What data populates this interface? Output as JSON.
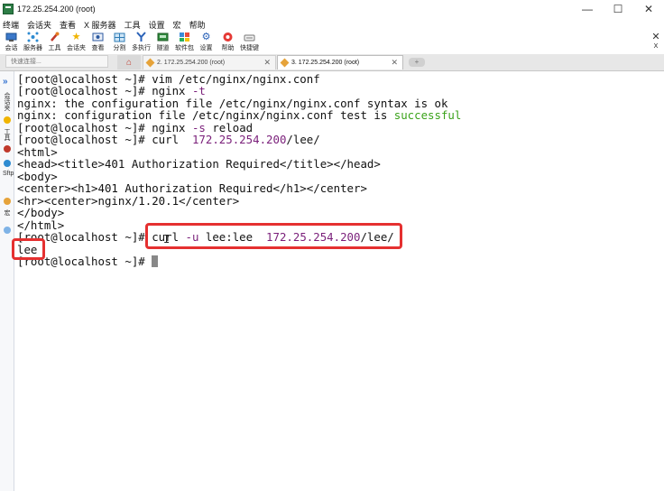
{
  "window": {
    "title": "172.25.254.200 (root)"
  },
  "window_controls": {
    "minimize": "—",
    "maximize": "☐",
    "close": "✕"
  },
  "menu": [
    "终端",
    "会话夹",
    "查看",
    "X 服务器",
    "工具",
    "设置",
    "宏",
    "帮助"
  ],
  "toolbar": {
    "items": [
      {
        "label": "会话",
        "icon": "session-icon"
      },
      {
        "label": "服务器",
        "icon": "servers-icon"
      },
      {
        "label": "工具",
        "icon": "tools-icon"
      },
      {
        "label": "会话夹",
        "icon": "star-icon"
      },
      {
        "label": "查看",
        "icon": "view-icon"
      },
      {
        "label": "分割",
        "icon": "split-icon"
      },
      {
        "label": "多执行",
        "icon": "multiexec-icon"
      },
      {
        "label": "隧道",
        "icon": "tunnel-icon"
      },
      {
        "label": "软件包",
        "icon": "packages-icon"
      },
      {
        "label": "设置",
        "icon": "settings-icon"
      },
      {
        "label": "帮助",
        "icon": "help-icon"
      },
      {
        "label": "快捷键",
        "icon": "keyboard-icon"
      }
    ],
    "right_label": "X"
  },
  "tabs": {
    "quick_connect_placeholder": "快速连接...",
    "items": [
      {
        "label": "2. 172.25.254.200 (root)"
      },
      {
        "label": "3. 172.25.254.200 (root)"
      }
    ]
  },
  "sidebar": {
    "labels": [
      "会话夹",
      "工具",
      "Sftp",
      "宏"
    ]
  },
  "terminal": {
    "lines": [
      [
        {
          "t": "[root@localhost ~]# vim /etc/nginx/nginx.conf",
          "c": "prompt"
        }
      ],
      [
        {
          "t": "[root@localhost ~]# nginx ",
          "c": "prompt"
        },
        {
          "t": "-t",
          "c": "opt"
        }
      ],
      [
        {
          "t": "nginx: the configuration file /etc/nginx/nginx.conf syntax is ok",
          "c": "prompt"
        }
      ],
      [
        {
          "t": "nginx: configuration file /etc/nginx/nginx.conf test is ",
          "c": "prompt"
        },
        {
          "t": "successful",
          "c": "ok"
        }
      ],
      [
        {
          "t": "[root@localhost ~]# nginx ",
          "c": "prompt"
        },
        {
          "t": "-s",
          "c": "opt"
        },
        {
          "t": " reload",
          "c": "prompt"
        }
      ],
      [
        {
          "t": "[root@localhost ~]# curl  ",
          "c": "prompt"
        },
        {
          "t": "172.25.254.200",
          "c": "num"
        },
        {
          "t": "/lee/",
          "c": "prompt"
        }
      ],
      [
        {
          "t": "<html>",
          "c": "prompt"
        }
      ],
      [
        {
          "t": "<head><title>401 Authorization Required</title></head>",
          "c": "prompt"
        }
      ],
      [
        {
          "t": "<body>",
          "c": "prompt"
        }
      ],
      [
        {
          "t": "<center><h1>401 Authorization Required</h1></center>",
          "c": "prompt"
        }
      ],
      [
        {
          "t": "<hr><center>nginx/1.20.1</center>",
          "c": "prompt"
        }
      ],
      [
        {
          "t": "</body>",
          "c": "prompt"
        }
      ],
      [
        {
          "t": "</html>",
          "c": "prompt"
        }
      ],
      [
        {
          "t": "[root@localhost ~]# curl ",
          "c": "prompt"
        },
        {
          "t": "-u",
          "c": "opt"
        },
        {
          "t": " lee:lee  ",
          "c": "prompt"
        },
        {
          "t": "172.25.254.200",
          "c": "num"
        },
        {
          "t": "/lee/",
          "c": "prompt"
        }
      ],
      [
        {
          "t": "lee",
          "c": "prompt"
        }
      ],
      [
        {
          "t": "[root@localhost ~]# ",
          "c": "prompt"
        }
      ]
    ]
  },
  "colors": {
    "highlight": "#e53030",
    "option": "#7a1f7a",
    "success": "#3aa21a"
  }
}
